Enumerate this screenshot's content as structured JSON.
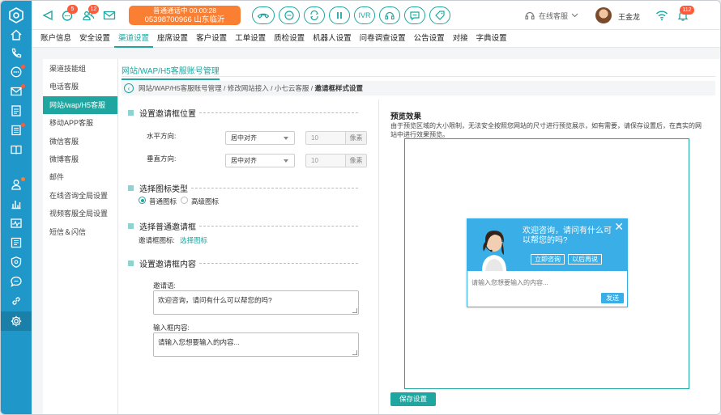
{
  "colors": {
    "brand_teal": "#1fa6a0",
    "rail_blue": "#1f97c9",
    "call_orange": "#fa7f32",
    "widget_blue": "#3aaee6",
    "badge_red": "#ff5a3c"
  },
  "rail": {
    "icons": [
      "home-icon",
      "phone-icon",
      "chat-icon",
      "mail-icon",
      "document-icon",
      "book-icon",
      "contacts-icon",
      "chart-icon",
      "monitor-icon",
      "list-icon",
      "shield-icon",
      "message-icon",
      "link-icon",
      "settings-icon"
    ]
  },
  "topbar": {
    "chat_badge": "5",
    "contacts_badge": "12",
    "call_status": "普通通话中  00:00:28",
    "call_number": "05398700966 山东临沂",
    "ivr_label": "IVR",
    "agent_status": "在线客服",
    "user_name": "王金龙",
    "notify_badge": "112"
  },
  "menubar": {
    "items": [
      "账户信息",
      "安全设置",
      "渠道设置",
      "座席设置",
      "客户设置",
      "工单设置",
      "质检设置",
      "机器人设置",
      "问卷调查设置",
      "公告设置",
      "对接",
      "字典设置"
    ],
    "active_index": 2
  },
  "subnav": {
    "items": [
      "渠道技能组",
      "电话客服",
      "网站/wap/H5客服",
      "移动APP客服",
      "微信客服",
      "微博客服",
      "邮件",
      "在线咨询全局设置",
      "视频客服全局设置",
      "短信＆闪信"
    ],
    "active_index": 2
  },
  "main": {
    "section_title": "网站/WAP/H5客服账号管理",
    "breadcrumb": {
      "p1": "网站/WAP/H5客服账号管理",
      "p2": "修改网站接入",
      "p3": "小七云客服",
      "current": "邀请框样式设置",
      "sep": " / "
    },
    "position": {
      "title": "设置邀请框位置",
      "horizontal_label": "水平方向:",
      "horizontal_value": "居中对齐",
      "horizontal_offset": "10",
      "vertical_label": "垂直方向:",
      "vertical_value": "居中对齐",
      "vertical_offset": "10",
      "unit": "像素"
    },
    "icon_type": {
      "title": "选择图标类型",
      "option_normal": "普通图标",
      "option_advanced": "高级图标"
    },
    "invite_box": {
      "title": "选择普通邀请框",
      "icon_label": "邀请框图标:",
      "icon_link": "选择图标"
    },
    "content": {
      "title": "设置邀请框内容",
      "greeting_label": "邀请语:",
      "greeting_value": "欢迎咨询，请问有什么可以帮您的吗?",
      "input_label": "输入框内容:",
      "input_value": "请输入您想要输入的内容..."
    },
    "save_label": "保存设置"
  },
  "preview": {
    "title": "预览效果",
    "description": "由于预览区域的大小限制，无法安全按照您网站的尺寸进行预览展示，如有需要，请保存设置后，在真实的网站中进行效果预览。",
    "widget": {
      "message": "欢迎咨询，请问有什么可以帮您的吗?",
      "btn_now": "立即咨询",
      "btn_later": "以后再说",
      "input_placeholder": "请输入您想要输入的内容...",
      "send_label": "发送"
    }
  }
}
